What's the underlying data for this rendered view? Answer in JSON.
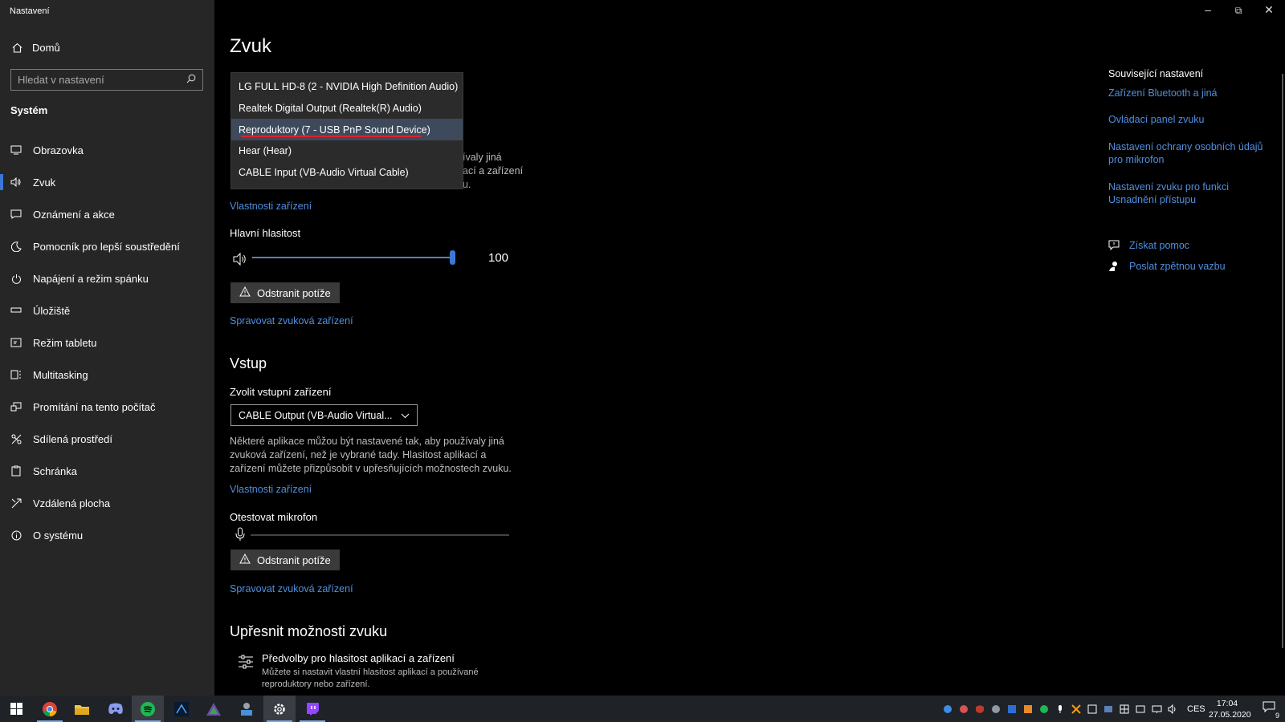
{
  "window": {
    "title": "Nastavení"
  },
  "sidebar": {
    "home_label": "Domů",
    "search_placeholder": "Hledat v nastavení",
    "section_title": "Systém",
    "items": [
      {
        "label": "Obrazovka",
        "icon": "monitor-icon"
      },
      {
        "label": "Zvuk",
        "icon": "speaker-icon"
      },
      {
        "label": "Oznámení a akce",
        "icon": "notification-icon"
      },
      {
        "label": "Pomocník pro lepší soustředění",
        "icon": "moon-icon"
      },
      {
        "label": "Napájení a režim spánku",
        "icon": "power-icon"
      },
      {
        "label": "Úložiště",
        "icon": "storage-icon"
      },
      {
        "label": "Režim tabletu",
        "icon": "tablet-icon"
      },
      {
        "label": "Multitasking",
        "icon": "multitasking-icon"
      },
      {
        "label": "Promítání na tento počítač",
        "icon": "projection-icon"
      },
      {
        "label": "Sdílená prostředí",
        "icon": "shared-icon"
      },
      {
        "label": "Schránka",
        "icon": "clipboard-icon"
      },
      {
        "label": "Vzdálená plocha",
        "icon": "remote-desktop-icon"
      },
      {
        "label": "O systému",
        "icon": "info-icon"
      }
    ],
    "active_item": "Zvuk"
  },
  "main": {
    "title": "Zvuk",
    "output": {
      "dropdown_options": [
        "LG FULL HD-8 (2 - NVIDIA High Definition Audio)",
        "Realtek Digital Output (Realtek(R) Audio)",
        "Reproduktory (7 - USB PnP Sound Device)",
        "Hear (Hear)",
        "CABLE Input (VB-Audio Virtual Cable)"
      ],
      "selected_option": "Reproduktory (7 - USB PnP Sound Device)",
      "partial_desc_line1": "ívaly jiná",
      "partial_desc_line2": "ací a zařízení",
      "partial_desc_line3": "u.",
      "device_properties_link": "Vlastnosti zařízení",
      "master_volume_label": "Hlavní hlasitost",
      "volume_value": "100",
      "troubleshoot_button": "Odstranit potíže",
      "manage_devices_link": "Spravovat zvuková zařízení"
    },
    "input": {
      "heading": "Vstup",
      "choose_label": "Zvolit vstupní zařízení",
      "selected_device": "CABLE Output (VB-Audio Virtual...",
      "description": "Některé aplikace můžou být nastavené tak, aby používaly jiná zvuková zařízení, než je vybrané tady. Hlasitost aplikací a zařízení můžete přizpůsobit v upřesňujících možnostech zvuku.",
      "device_properties_link": "Vlastnosti zařízení",
      "test_mic_label": "Otestovat mikrofon",
      "troubleshoot_button": "Odstranit potíže",
      "manage_devices_link": "Spravovat zvuková zařízení"
    },
    "advanced": {
      "heading": "Upřesnit možnosti zvuku",
      "item_title": "Předvolby pro hlasitost aplikací a zařízení",
      "item_desc": "Můžete si nastavit vlastní hlasitost aplikací a používané reproduktory nebo zařízení."
    }
  },
  "related": {
    "title": "Související nastavení",
    "links": [
      "Zařízení Bluetooth a jiná",
      "Ovládací panel zvuku",
      "Nastavení ochrany osobních údajů pro mikrofon",
      "Nastavení zvuku pro funkci Usnadnění přístupu"
    ],
    "help_link": "Získat pomoc",
    "feedback_link": "Poslat zpětnou vazbu"
  },
  "taskbar": {
    "apps": [
      "start-icon",
      "chrome-icon",
      "file-explorer-icon",
      "discord-icon",
      "spotify-icon",
      "obs-icon",
      "app-icon",
      "app2-icon",
      "settings-icon",
      "twitch-icon"
    ],
    "language": "CES",
    "time": "17:04",
    "date": "27.05.2020",
    "notification_count": "9"
  },
  "colors": {
    "accent": "#3b78d6",
    "link": "#4f8fe0",
    "sidebar_bg": "#262626",
    "underline": "#e0222a"
  }
}
